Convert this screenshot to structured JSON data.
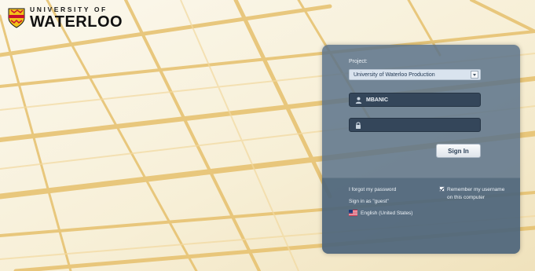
{
  "brand": {
    "line1": "UNIVERSITY OF",
    "line2": "WATERLOO"
  },
  "login": {
    "project_label": "Project:",
    "project_value": "University of Waterloo Production",
    "username_value": "MBANIC",
    "password_value": "",
    "sign_in_label": "Sign In"
  },
  "footer": {
    "forgot_password": "I forgot my password",
    "sign_in_guest": "Sign in as \"guest\"",
    "language": "English (United States)",
    "remember_line1": "Remember my username",
    "remember_line2": "on this computer",
    "remember_checked": true
  },
  "icons": {
    "user": "user-icon",
    "lock": "lock-icon",
    "dropdown": "chevron-down-icon",
    "flag": "us-flag-icon",
    "crest": "crest-icon"
  },
  "colors": {
    "panel": "#5c738a",
    "field": "#34465a",
    "background": "#f6f0de",
    "beam": "#e8c679"
  }
}
